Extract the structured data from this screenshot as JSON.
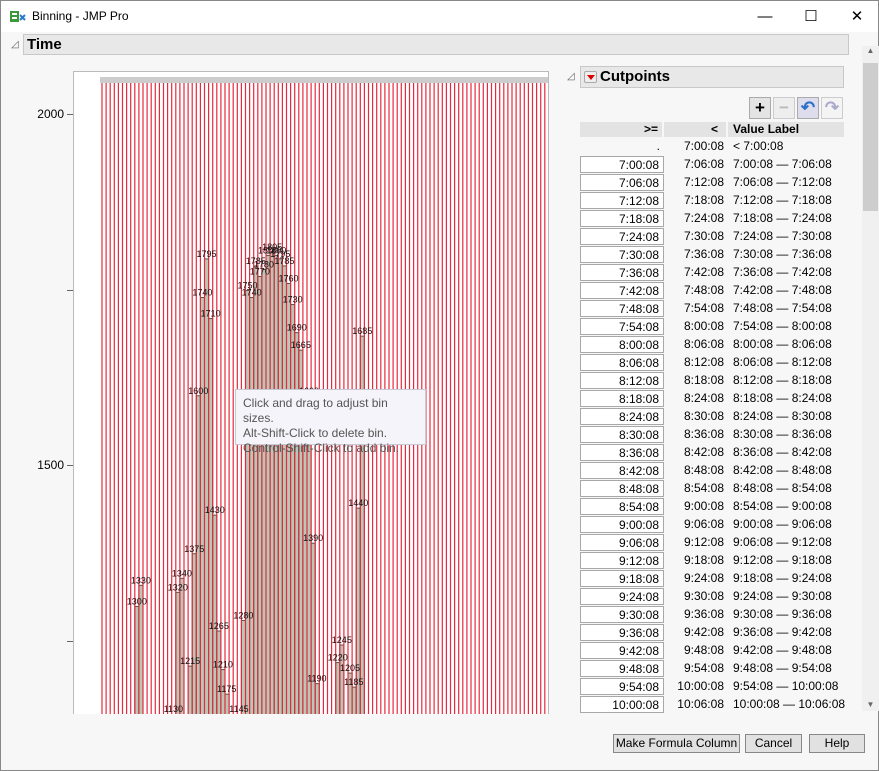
{
  "window": {
    "title": "Binning - JMP Pro",
    "minimize": "—",
    "maximize": "☐",
    "close": "✕"
  },
  "section": {
    "title": "Time"
  },
  "chart_data": {
    "type": "bar",
    "title": "Time histogram with cutpoints",
    "ylim": [
      1145,
      2030
    ],
    "yticks": [
      {
        "value": 2000,
        "label": "2000"
      },
      {
        "value": 1750,
        "label": ""
      },
      {
        "value": 1500,
        "label": "1500"
      },
      {
        "value": 1250,
        "label": ""
      }
    ],
    "cutpoint_count": 109,
    "bins": [
      {
        "bin": 8,
        "value": 1300
      },
      {
        "bin": 9,
        "value": 1330
      },
      {
        "bin": 17,
        "value": 1130
      },
      {
        "bin": 18,
        "value": 1320
      },
      {
        "bin": 19,
        "value": 1340
      },
      {
        "bin": 21,
        "value": 1215
      },
      {
        "bin": 22,
        "value": 1375
      },
      {
        "bin": 23,
        "value": 1600
      },
      {
        "bin": 24,
        "value": 1740
      },
      {
        "bin": 25,
        "value": 1795
      },
      {
        "bin": 26,
        "value": 1710
      },
      {
        "bin": 27,
        "value": 1430
      },
      {
        "bin": 28,
        "value": 1265
      },
      {
        "bin": 29,
        "value": 1210
      },
      {
        "bin": 30,
        "value": 1175
      },
      {
        "bin": 33,
        "value": 1145
      },
      {
        "bin": 34,
        "value": 1280
      },
      {
        "bin": 35,
        "value": 1750
      },
      {
        "bin": 36,
        "value": 1740
      },
      {
        "bin": 37,
        "value": 1785
      },
      {
        "bin": 38,
        "value": 1770
      },
      {
        "bin": 39,
        "value": 1780
      },
      {
        "bin": 40,
        "value": 1800
      },
      {
        "bin": 41,
        "value": 1805
      },
      {
        "bin": 42,
        "value": 1800
      },
      {
        "bin": 43,
        "value": 1795
      },
      {
        "bin": 44,
        "value": 1785
      },
      {
        "bin": 45,
        "value": 1760
      },
      {
        "bin": 46,
        "value": 1730
      },
      {
        "bin": 47,
        "value": 1690
      },
      {
        "bin": 48,
        "value": 1665
      },
      {
        "bin": 49,
        "value": 1585
      },
      {
        "bin": 50,
        "value": 1600
      },
      {
        "bin": 51,
        "value": 1390
      },
      {
        "bin": 52,
        "value": 1190
      },
      {
        "bin": 57,
        "value": 1220
      },
      {
        "bin": 58,
        "value": 1245
      },
      {
        "bin": 60,
        "value": 1205
      },
      {
        "bin": 61,
        "value": 1185
      },
      {
        "bin": 62,
        "value": 1440
      },
      {
        "bin": 63,
        "value": 1685
      }
    ]
  },
  "tooltip": {
    "lines": [
      "Click and drag to adjust bin sizes.",
      "Alt-Shift-Click to delete bin.",
      "Control-Shift-Click to add bin."
    ]
  },
  "cutpoints": {
    "title": "Cutpoints",
    "toolbar": {
      "add": "+",
      "remove": "−",
      "undo": "↶",
      "redo": "↷"
    },
    "headers": {
      "ge": ">=",
      "lt": "<",
      "label": "Value Label"
    },
    "rows": [
      [
        ".",
        "7:00:08",
        "< 7:00:08"
      ],
      [
        "7:00:08",
        "7:06:08",
        "7:00:08 — 7:06:08"
      ],
      [
        "7:06:08",
        "7:12:08",
        "7:06:08 — 7:12:08"
      ],
      [
        "7:12:08",
        "7:18:08",
        "7:12:08 — 7:18:08"
      ],
      [
        "7:18:08",
        "7:24:08",
        "7:18:08 — 7:24:08"
      ],
      [
        "7:24:08",
        "7:30:08",
        "7:24:08 — 7:30:08"
      ],
      [
        "7:30:08",
        "7:36:08",
        "7:30:08 — 7:36:08"
      ],
      [
        "7:36:08",
        "7:42:08",
        "7:36:08 — 7:42:08"
      ],
      [
        "7:42:08",
        "7:48:08",
        "7:42:08 — 7:48:08"
      ],
      [
        "7:48:08",
        "7:54:08",
        "7:48:08 — 7:54:08"
      ],
      [
        "7:54:08",
        "8:00:08",
        "7:54:08 — 8:00:08"
      ],
      [
        "8:00:08",
        "8:06:08",
        "8:00:08 — 8:06:08"
      ],
      [
        "8:06:08",
        "8:12:08",
        "8:06:08 — 8:12:08"
      ],
      [
        "8:12:08",
        "8:18:08",
        "8:12:08 — 8:18:08"
      ],
      [
        "8:18:08",
        "8:24:08",
        "8:18:08 — 8:24:08"
      ],
      [
        "8:24:08",
        "8:30:08",
        "8:24:08 — 8:30:08"
      ],
      [
        "8:30:08",
        "8:36:08",
        "8:30:08 — 8:36:08"
      ],
      [
        "8:36:08",
        "8:42:08",
        "8:36:08 — 8:42:08"
      ],
      [
        "8:42:08",
        "8:48:08",
        "8:42:08 — 8:48:08"
      ],
      [
        "8:48:08",
        "8:54:08",
        "8:48:08 — 8:54:08"
      ],
      [
        "8:54:08",
        "9:00:08",
        "8:54:08 — 9:00:08"
      ],
      [
        "9:00:08",
        "9:06:08",
        "9:00:08 — 9:06:08"
      ],
      [
        "9:06:08",
        "9:12:08",
        "9:06:08 — 9:12:08"
      ],
      [
        "9:12:08",
        "9:18:08",
        "9:12:08 — 9:18:08"
      ],
      [
        "9:18:08",
        "9:24:08",
        "9:18:08 — 9:24:08"
      ],
      [
        "9:24:08",
        "9:30:08",
        "9:24:08 — 9:30:08"
      ],
      [
        "9:30:08",
        "9:36:08",
        "9:30:08 — 9:36:08"
      ],
      [
        "9:36:08",
        "9:42:08",
        "9:36:08 — 9:42:08"
      ],
      [
        "9:42:08",
        "9:48:08",
        "9:42:08 — 9:48:08"
      ],
      [
        "9:48:08",
        "9:54:08",
        "9:48:08 — 9:54:08"
      ],
      [
        "9:54:08",
        "10:00:08",
        "9:54:08 — 10:00:08"
      ],
      [
        "10:00:08",
        "10:06:08",
        "10:00:08 — 10:06:08"
      ]
    ]
  },
  "buttons": {
    "make_formula": "Make Formula Column",
    "cancel": "Cancel",
    "help": "Help"
  },
  "colors": {
    "cutline": "#e8283c",
    "bar": "#b9c7b6",
    "bar_border": "#4a5a48"
  }
}
